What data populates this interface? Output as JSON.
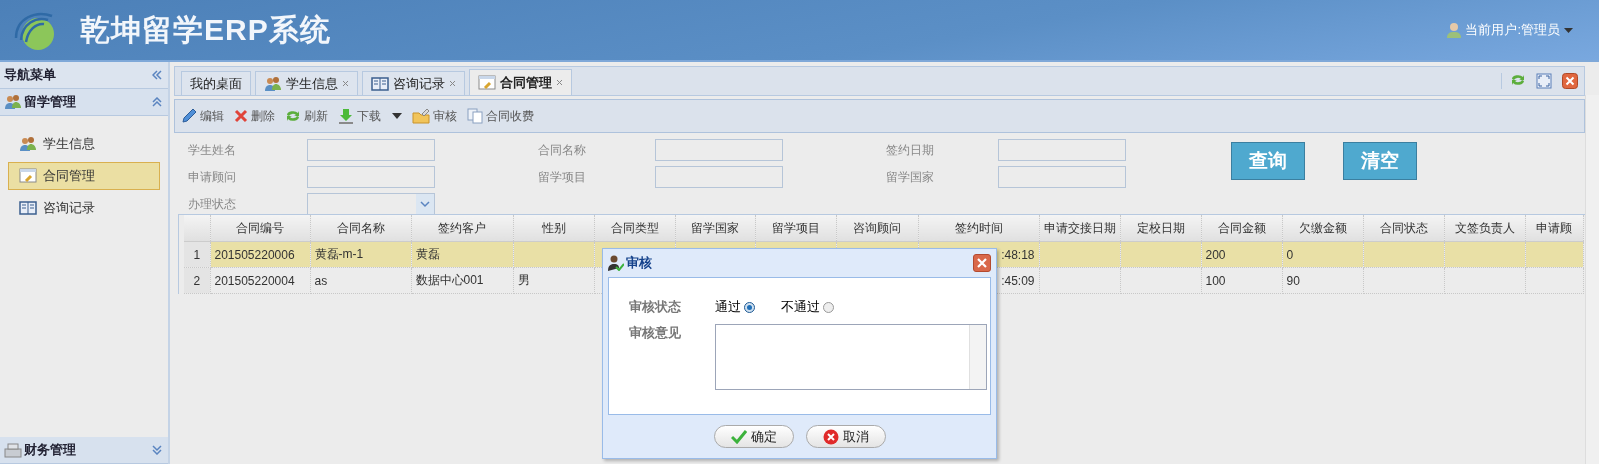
{
  "header": {
    "title": "乾坤留学ERP系统",
    "user": "当前用户:管理员"
  },
  "sidebar": {
    "title": "导航菜单",
    "sections": [
      {
        "label": "留学管理",
        "expanded": true,
        "items": [
          {
            "label": "学生信息",
            "selected": false
          },
          {
            "label": "合同管理",
            "selected": true
          },
          {
            "label": "咨询记录",
            "selected": false
          }
        ]
      },
      {
        "label": "财务管理",
        "expanded": false
      }
    ]
  },
  "tabs": [
    {
      "label": "我的桌面",
      "closable": false,
      "selected": false
    },
    {
      "label": "学生信息",
      "closable": true,
      "selected": false
    },
    {
      "label": "咨询记录",
      "closable": true,
      "selected": false
    },
    {
      "label": "合同管理",
      "closable": true,
      "selected": true
    }
  ],
  "toolbar": [
    {
      "label": "编辑",
      "dropdown": false
    },
    {
      "label": "删除",
      "dropdown": false
    },
    {
      "label": "刷新",
      "dropdown": false
    },
    {
      "label": "下载",
      "dropdown": true
    },
    {
      "label": "审核",
      "dropdown": false
    },
    {
      "label": "合同收费",
      "dropdown": false
    }
  ],
  "filters": [
    [
      {
        "label": "学生姓名",
        "kind": "text"
      },
      {
        "label": "合同名称",
        "kind": "text"
      },
      {
        "label": "签约日期",
        "kind": "text"
      }
    ],
    [
      {
        "label": "申请顾问",
        "kind": "text"
      },
      {
        "label": "留学项目",
        "kind": "text"
      },
      {
        "label": "留学国家",
        "kind": "text"
      }
    ],
    [
      {
        "label": "办理状态",
        "kind": "select"
      }
    ]
  ],
  "buttons": [
    "查询",
    "清空"
  ],
  "table": {
    "columns": [
      "合同编号",
      "合同名称",
      "签约客户",
      "性别",
      "合同类型",
      "留学国家",
      "留学项目",
      "咨询顾问",
      "签约时间",
      "申请交接日期",
      "定校日期",
      "合同金额",
      "欠缴金额",
      "合同状态",
      "文签负责人",
      "申请顾"
    ],
    "rows": [
      {
        "index": "1",
        "selected": true,
        "cells": [
          "201505220006",
          "黄磊-m-1",
          "黄磊",
          "",
          "",
          "",
          "",
          "",
          ":48:18",
          "",
          "",
          "200",
          "0",
          "",
          "",
          ""
        ]
      },
      {
        "index": "2",
        "selected": false,
        "cells": [
          "201505220004",
          "as",
          "数据中心001",
          "男",
          "",
          "",
          "",
          "",
          ":45:09",
          "",
          "",
          "100",
          "90",
          "",
          "",
          ""
        ]
      }
    ]
  },
  "dialog": {
    "title": "审核",
    "status_label": "审核状态",
    "options": [
      {
        "label": "通过",
        "selected": true
      },
      {
        "label": "不通过",
        "selected": false
      }
    ],
    "comment_label": "审核意见",
    "ok": "确定",
    "cancel": "取消"
  }
}
